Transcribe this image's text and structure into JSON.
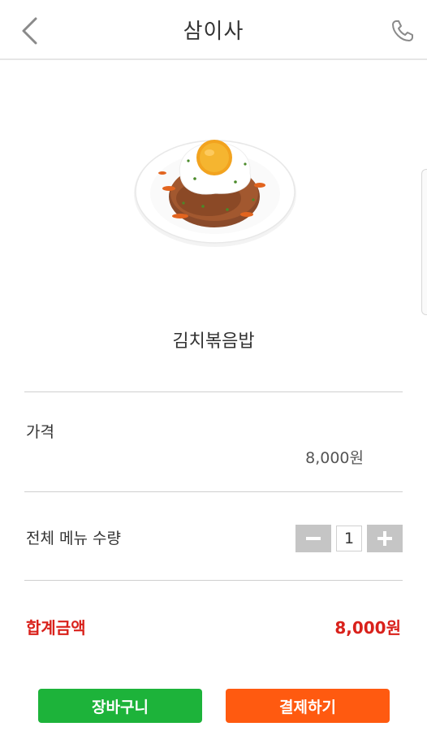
{
  "header": {
    "title": "삼이사",
    "back_icon": "chevron-left-icon",
    "phone_icon": "phone-icon"
  },
  "menu": {
    "name": "김치볶음밥",
    "image": "kimchi-fried-rice-with-egg"
  },
  "price": {
    "label": "가격",
    "value": "8,000원"
  },
  "quantity": {
    "label": "전체 메뉴 수량",
    "value": "1",
    "minus_icon": "minus-icon",
    "plus_icon": "plus-icon"
  },
  "total": {
    "label": "합계금액",
    "value": "8,000원"
  },
  "actions": {
    "cart_label": "장바구니",
    "pay_label": "결제하기"
  },
  "colors": {
    "total_red": "#d9211b",
    "cart_green": "#1db33a",
    "pay_orange": "#ff5a10",
    "stepper_gray": "#c5c5c5"
  }
}
